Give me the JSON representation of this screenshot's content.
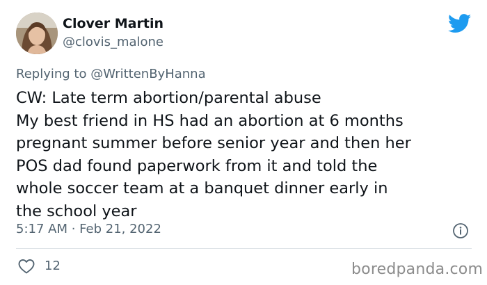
{
  "author": {
    "display_name": "Clover Martin",
    "handle": "@clovis_malone",
    "avatar": "profile-photo"
  },
  "reply_context": {
    "prefix": "Replying to",
    "mention": "@WrittenByHanna"
  },
  "tweet": {
    "lines": [
      "CW: Late term abortion/parental abuse",
      "My best friend in HS had an abortion at 6 months",
      "pregnant summer before senior year and then her",
      "POS dad found paperwork from it and told the",
      "whole soccer team at a banquet dinner early in",
      "the school year"
    ],
    "timestamp": "5:17 AM · Feb 21, 2022",
    "like_count": "12"
  },
  "icons": {
    "logo": "twitter-bird-icon",
    "info": "info-icon",
    "like": "heart-icon"
  },
  "watermark": "boredpanda.com",
  "colors": {
    "twitter_blue": "#1d9bf0",
    "text_primary": "#0f1419",
    "text_secondary": "#536471",
    "divider": "#dfe4e8",
    "watermark": "#8c8c8c"
  }
}
